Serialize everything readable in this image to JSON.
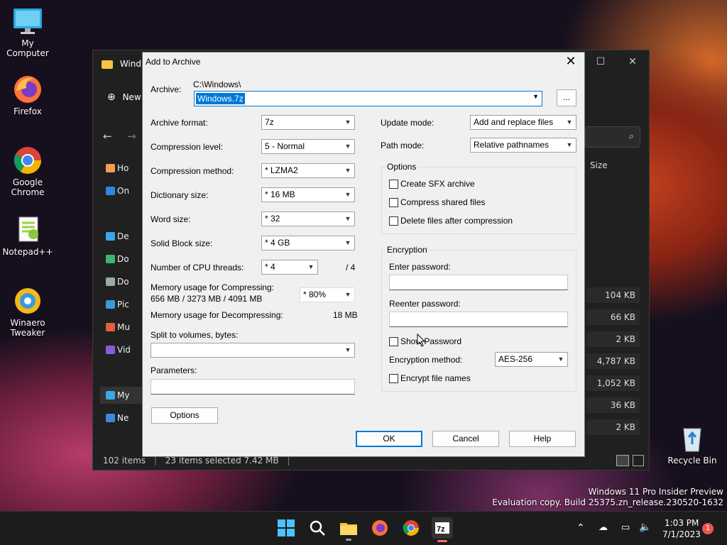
{
  "desktop": {
    "icons": [
      {
        "label": "My Computer",
        "icon": "computer-icon"
      },
      {
        "label": "Firefox",
        "icon": "firefox-icon"
      },
      {
        "label": "Google Chrome",
        "icon": "chrome-icon"
      },
      {
        "label": "Notepad++",
        "icon": "notepadpp-icon"
      },
      {
        "label": "Winaero Tweaker",
        "icon": "winaero-icon"
      },
      {
        "label": "Recycle Bin",
        "icon": "recycle-bin-icon"
      }
    ],
    "watermark": {
      "line1": "Windows 11 Pro Insider Preview",
      "line2": "Evaluation copy. Build 25375.zn_release.230520-1632"
    }
  },
  "explorer": {
    "tab": "Wind",
    "new_label": "New",
    "sidebar": [
      "Ho",
      "On",
      "De",
      "Do",
      "Do",
      "Pic",
      "Mu",
      "Vid",
      "My",
      "Ne"
    ],
    "column_size": "Size",
    "sizes": [
      "104 KB",
      "66 KB",
      "2 KB",
      "4,787 KB",
      "1,052 KB",
      "36 KB",
      "2 KB"
    ],
    "status": {
      "items": "102 items",
      "selected": "23 items selected  7.42 MB"
    }
  },
  "dialog": {
    "title": "Add to Archive",
    "archive_label": "Archive:",
    "archive_path": "C:\\Windows\\",
    "archive_name": "Windows.7z",
    "browse_label": "...",
    "left": {
      "format_label": "Archive format:",
      "format": "7z",
      "level_label": "Compression level:",
      "level": "5 - Normal",
      "method_label": "Compression method:",
      "method": "*  LZMA2",
      "dict_label": "Dictionary size:",
      "dict": "*  16 MB",
      "word_label": "Word size:",
      "word": "*  32",
      "solid_label": "Solid Block size:",
      "solid": "*  4 GB",
      "threads_label": "Number of CPU threads:",
      "threads": "*  4",
      "threads_max": "/ 4",
      "mem_comp_label": "Memory usage for Compressing:",
      "mem_comp_value": "656 MB / 3273 MB / 4091 MB",
      "mem_pct": "* 80%",
      "mem_decomp_label": "Memory usage for Decompressing:",
      "mem_decomp_value": "18 MB",
      "split_label": "Split to volumes, bytes:",
      "split": "",
      "params_label": "Parameters:",
      "params": "",
      "options_button": "Options"
    },
    "right": {
      "update_label": "Update mode:",
      "update": "Add and replace files",
      "path_label": "Path mode:",
      "path": "Relative pathnames",
      "options_group": "Options",
      "sfx": "Create SFX archive",
      "shared": "Compress shared files",
      "delete": "Delete files after compression",
      "encryption_group": "Encryption",
      "enter_pw": "Enter password:",
      "reenter_pw": "Reenter password:",
      "show_pw": "Show Password",
      "enc_method_label": "Encryption method:",
      "enc_method": "AES-256",
      "enc_names": "Encrypt file names"
    },
    "buttons": {
      "ok": "OK",
      "cancel": "Cancel",
      "help": "Help"
    }
  },
  "taskbar": {
    "time": "1:03 PM",
    "date": "7/1/2023",
    "notif_count": "1"
  },
  "colors": {
    "accent": "#0078d7"
  }
}
